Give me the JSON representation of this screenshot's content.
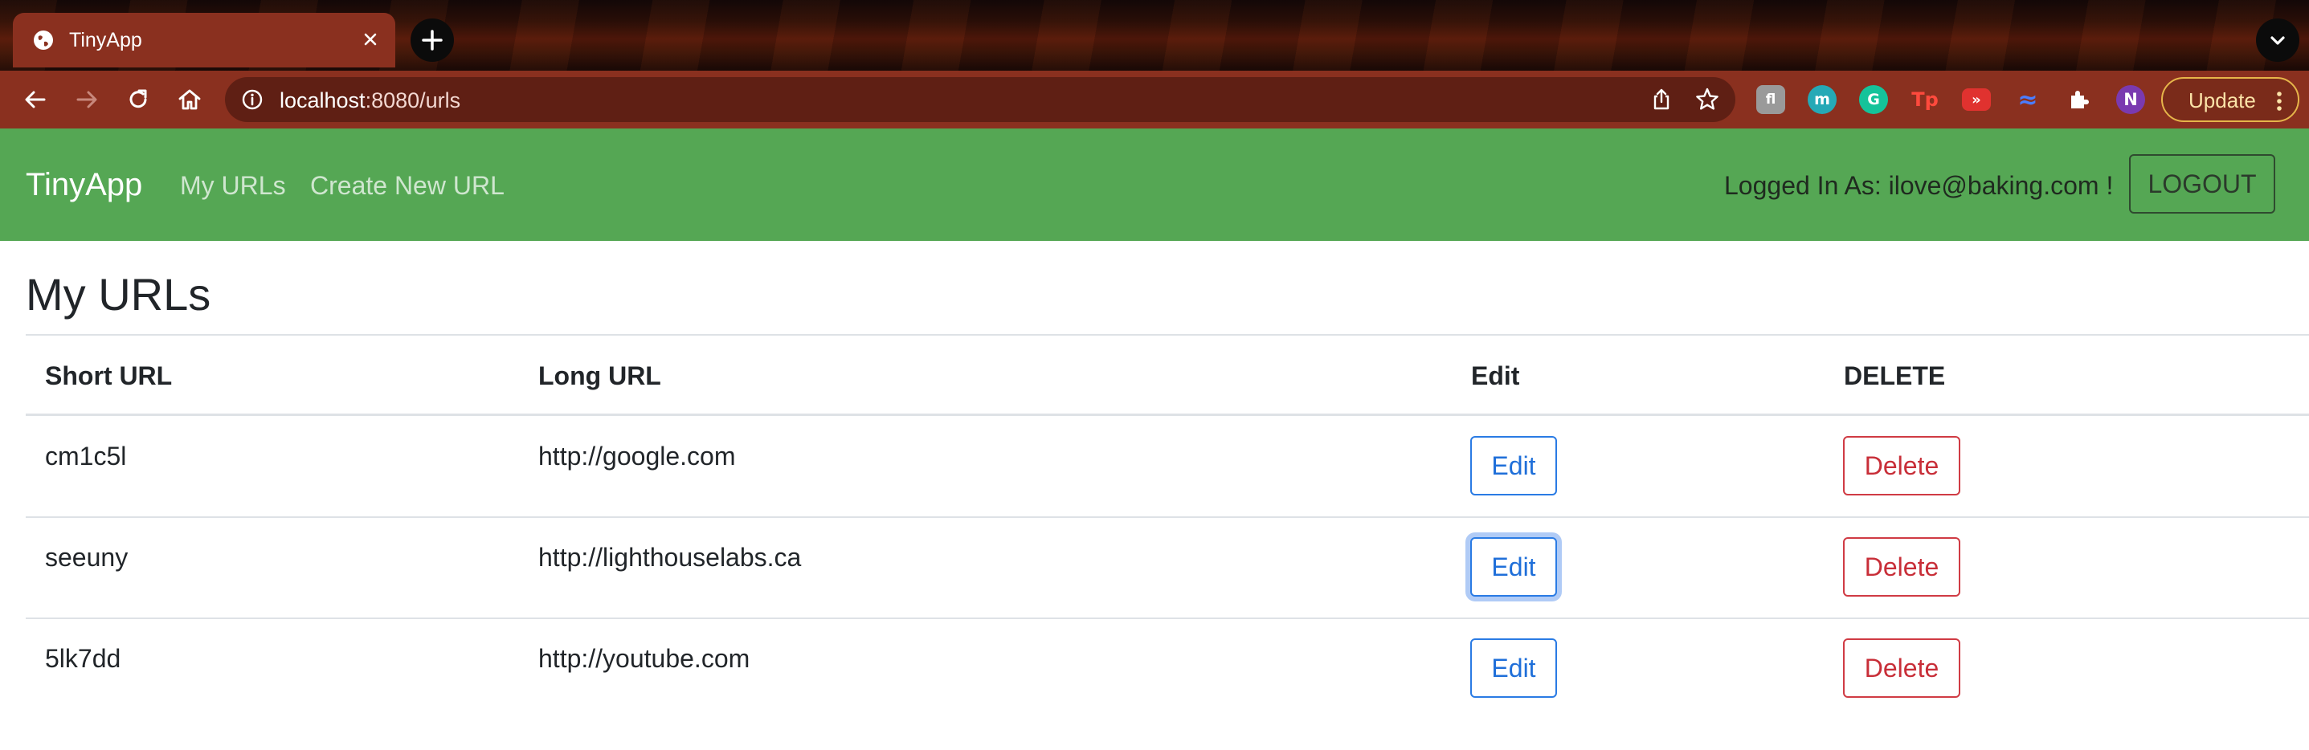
{
  "browser": {
    "tab_title": "TinyApp",
    "url_host": "localhost",
    "url_rest": ":8080/urls",
    "update_label": "Update",
    "profile_initial": "N",
    "extensions": [
      {
        "name": "fl-extension",
        "glyph": "fl",
        "color": "#9a9a9a"
      },
      {
        "name": "m-extension",
        "glyph": "m",
        "color": "#25a9b6"
      },
      {
        "name": "grammarly-extension",
        "glyph": "G",
        "color": "#15c39a"
      },
      {
        "name": "tp-extension",
        "glyph": "Tp",
        "color": "#e0322f"
      },
      {
        "name": "forward-extension",
        "glyph": "»",
        "color": "#e0322f"
      },
      {
        "name": "wave-extension",
        "glyph": "≈",
        "color": "#3b6fe0"
      }
    ]
  },
  "navbar": {
    "brand": "TinyApp",
    "links": [
      "My URLs",
      "Create New URL"
    ],
    "logged_in": "Logged In As: ilove@baking.com !",
    "logout": "LOGOUT"
  },
  "main": {
    "title": "My URLs",
    "columns": [
      "Short URL",
      "Long URL",
      "Edit",
      "DELETE"
    ],
    "rows": [
      {
        "short": "cm1c5l",
        "long": "http://google.com",
        "edit": "Edit",
        "delete": "Delete"
      },
      {
        "short": "seeuny",
        "long": "http://lighthouselabs.ca",
        "edit": "Edit",
        "delete": "Delete"
      },
      {
        "short": "5lk7dd",
        "long": "http://youtube.com",
        "edit": "Edit",
        "delete": "Delete"
      }
    ]
  },
  "colors": {
    "navbar": "#55a754",
    "edit": "#2a7be4",
    "delete": "#d03b44"
  }
}
